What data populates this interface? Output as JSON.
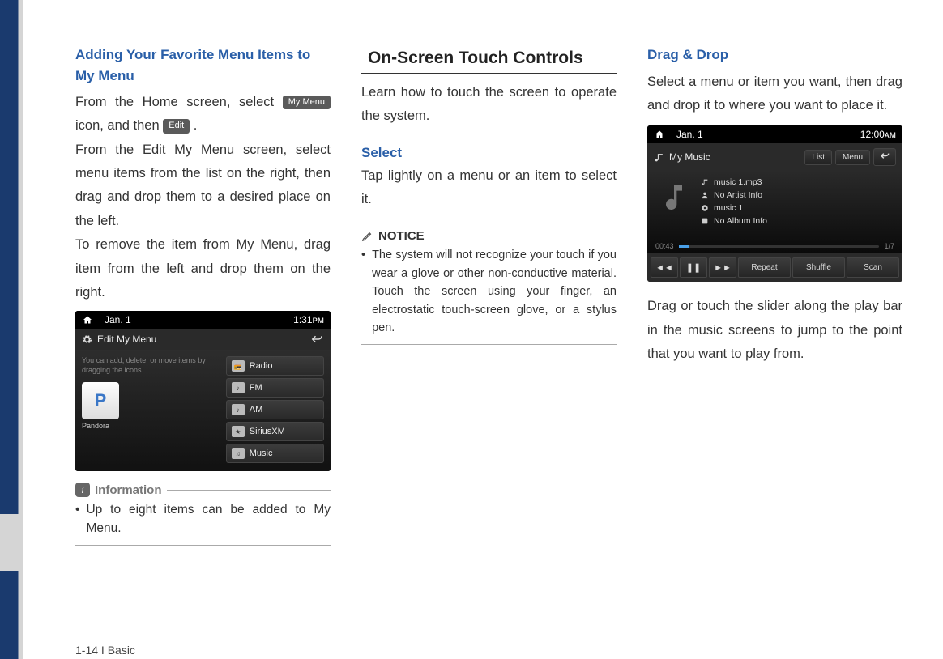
{
  "col1": {
    "heading": "Adding Your Favorite Menu Items to My Menu",
    "p1a": "From the Home screen, select ",
    "btn_mymenu": "My Menu",
    "p1b": " icon, and then ",
    "btn_edit": "Edit",
    "p1c": " .",
    "p2": "From the Edit My Menu screen, select menu items from the list on the right, then drag and drop them to a desired place on the left.",
    "p3": "To remove the item from My Menu, drag item from the left and drop them on the right.",
    "screenshot1": {
      "date": "Jan.  1",
      "time": "1:31ᴘᴍ",
      "title": "Edit My Menu",
      "hint": "You can add, delete, or move items by dragging the icons.",
      "app_letter": "P",
      "app_label": "Pandora",
      "list": [
        "Radio",
        "FM",
        "AM",
        "SiriusXM",
        "Music"
      ]
    },
    "info_label": "Information",
    "info_bullet": "Up to eight items can be added to My Menu."
  },
  "col2": {
    "section": "On-Screen Touch Controls",
    "intro": "Learn how to touch the screen to operate the system.",
    "select_h": "Select",
    "select_p": "Tap lightly on a menu or an item to select it.",
    "notice_label": "NOTICE",
    "notice_bullet": "The system will not recognize your touch if you wear a glove or other non-conductive material. Touch the screen using your finger, an electrostatic touch-screen glove, or a stylus pen."
  },
  "col3": {
    "heading": "Drag & Drop",
    "p1": "Select a menu or item you want, then drag and drop it to where you want to place it.",
    "screenshot2": {
      "date": "Jan.  1",
      "time": "12:00ᴀᴍ",
      "title": "My Music",
      "btn_list": "List",
      "btn_menu": "Menu",
      "track": "music 1.mp3",
      "artist": "No Artist Info",
      "song": "music 1",
      "album": "No Album Info",
      "time_elapsed": "00:43",
      "counter": "1/7",
      "ctrl_repeat": "Repeat",
      "ctrl_shuffle": "Shuffle",
      "ctrl_scan": "Scan"
    },
    "p2": "Drag or touch the slider along the play bar in the music screens to jump to the point that you want to play from."
  },
  "footer": "1-14 I Basic"
}
